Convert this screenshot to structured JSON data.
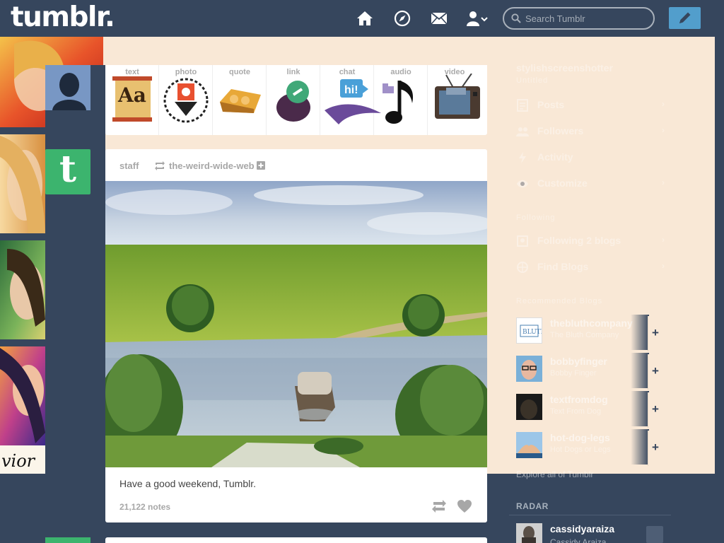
{
  "header": {
    "logo": "tumblr.",
    "search": {
      "placeholder": "Search Tumblr",
      "value": ""
    },
    "icons": [
      "home-icon",
      "explore-compass-icon",
      "inbox-envelope-icon",
      "account-icon",
      "compose-pencil-icon"
    ]
  },
  "post_types": [
    {
      "name": "text",
      "label": "text",
      "icon": "text-aa-icon"
    },
    {
      "name": "photo",
      "label": "photo",
      "icon": "photo-camera-icon"
    },
    {
      "name": "quote",
      "label": "quote",
      "icon": "quote-icon"
    },
    {
      "name": "link",
      "label": "link",
      "icon": "link-icon"
    },
    {
      "name": "chat",
      "label": "chat",
      "icon": "chat-bubble-icon"
    },
    {
      "name": "audio",
      "label": "audio",
      "icon": "audio-headphones-icon"
    },
    {
      "name": "video",
      "label": "video",
      "icon": "video-tv-icon"
    }
  ],
  "post": {
    "author": "staff",
    "reblogged_from": "the-weird-wide-web",
    "caption": "Have a good weekend, Tumblr.",
    "notes": "21,122 notes"
  },
  "sidebar": {
    "blog_name": "stylishscreenshotter",
    "blog_sub": "Untitled",
    "items": [
      {
        "label": "Posts",
        "icon": "posts-icon"
      },
      {
        "label": "Followers",
        "icon": "followers-icon"
      },
      {
        "label": "Activity",
        "icon": "activity-icon"
      },
      {
        "label": "Customize",
        "icon": "customize-eye-icon"
      }
    ],
    "section_label": "Following",
    "following": [
      {
        "label": "Following 2 blogs",
        "icon": "following-icon"
      },
      {
        "label": "Find Blogs",
        "icon": "find-blogs-icon"
      }
    ],
    "recommended_label": "Recommended Blogs",
    "recommended": [
      {
        "name": "thebluthcompany",
        "sub": "The Bluth Company"
      },
      {
        "name": "bobbyfinger",
        "sub": "Bobby Finger"
      },
      {
        "name": "textfromdog",
        "sub": "Text From Dog"
      },
      {
        "name": "hot-dog-legs",
        "sub": "Hot Dogs or Legs"
      }
    ],
    "explore": "Explore all of Tumblr"
  },
  "radar": {
    "heading": "RADAR",
    "name": "cassidyaraiza",
    "sub": "Cassidy Araiza"
  },
  "colors": {
    "navy": "#36465d",
    "peach_overlay": "#f9e8d6",
    "compose_blue": "#529ecc",
    "staff_green": "#3cb46e"
  }
}
